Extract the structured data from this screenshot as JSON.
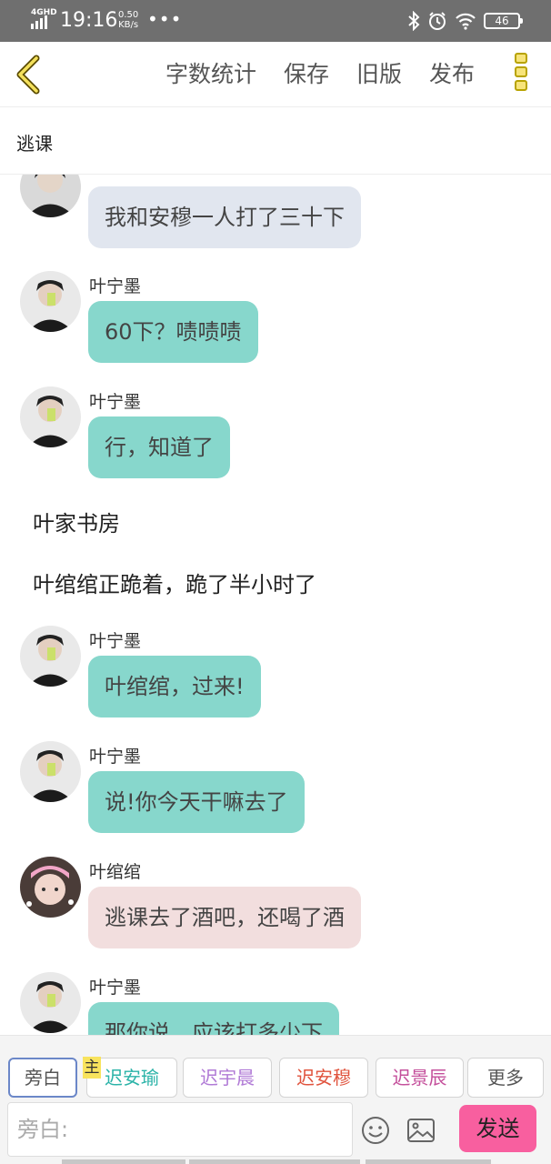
{
  "status_bar": {
    "network": "4GHD",
    "time": "19:16",
    "speed_value": "0.50",
    "speed_unit": "KB/s",
    "dots": "•••",
    "battery": "46",
    "icons": [
      "bluetooth-icon",
      "alarm-icon",
      "wifi-icon",
      "battery-icon"
    ]
  },
  "toolbar": {
    "back_icon": "chevron-left-icon",
    "actions": [
      "字数统计",
      "保存",
      "旧版",
      "发布"
    ],
    "more_icon": "three-boxes-menu-icon"
  },
  "story": {
    "title": "逃课"
  },
  "messages": [
    {
      "type": "chat",
      "speaker": "",
      "text": "我和安穆一人打了三十下",
      "bubble_color": "gray"
    },
    {
      "type": "chat",
      "speaker": "叶宁墨",
      "text": "60下？啧啧啧",
      "bubble_color": "teal"
    },
    {
      "type": "chat",
      "speaker": "叶宁墨",
      "text": "行，知道了",
      "bubble_color": "teal"
    },
    {
      "type": "narration",
      "text": "叶家书房"
    },
    {
      "type": "narration",
      "text": "叶绾绾正跪着，跪了半小时了"
    },
    {
      "type": "chat",
      "speaker": "叶宁墨",
      "text": "叶绾绾，过来!",
      "bubble_color": "teal"
    },
    {
      "type": "chat",
      "speaker": "叶宁墨",
      "text": "说!你今天干嘛去了",
      "bubble_color": "teal"
    },
    {
      "type": "chat",
      "speaker": "叶绾绾",
      "text": "逃课去了酒吧，还喝了酒",
      "bubble_color": "pink"
    },
    {
      "type": "chat",
      "speaker": "叶宁墨",
      "text": "那你说，应该打多少下",
      "bubble_color": "teal"
    }
  ],
  "roles": [
    {
      "label": "旁白",
      "color": "#555555",
      "selected": true
    },
    {
      "label": "迟安瑜",
      "color": "#2bb3a8",
      "selected": false,
      "tag": "主"
    },
    {
      "label": "迟宇晨",
      "color": "#b07ad6",
      "selected": false
    },
    {
      "label": "迟安穆",
      "color": "#e0533d",
      "selected": false
    },
    {
      "label": "迟景辰",
      "color": "#c44f9b",
      "selected": false
    },
    {
      "label": "更多",
      "color": "#555555",
      "selected": false
    }
  ],
  "composer": {
    "placeholder": "旁白:",
    "emoji_icon": "smiley-icon",
    "image_icon": "image-icon",
    "send_label": "发送"
  },
  "colors": {
    "status_bar": "#6f6f6f",
    "teal_bubble": "#87d7cc",
    "gray_bubble": "#e1e6ef",
    "pink_bubble": "#f2dede",
    "send_button": "#f85f9f",
    "accent_yellow": "#f7e47a"
  }
}
